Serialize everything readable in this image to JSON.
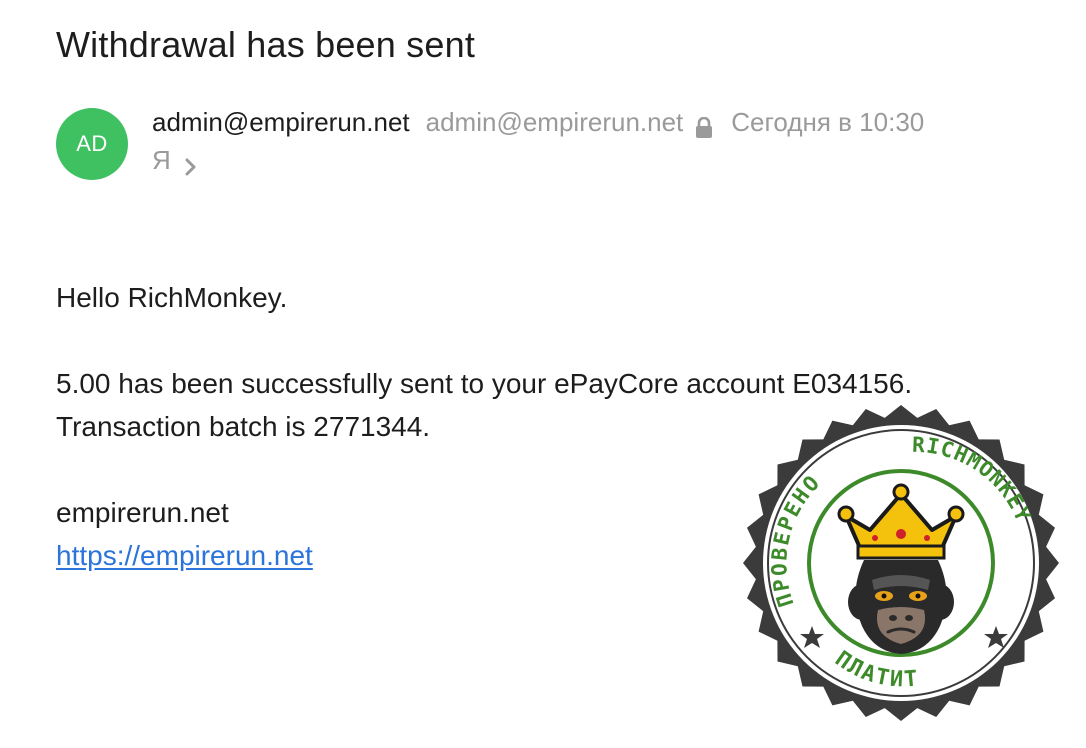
{
  "email": {
    "subject": "Withdrawal has been sent",
    "avatar_initials": "AD",
    "sender_name": "admin@empirerun.net",
    "sender_email": "admin@empirerun.net",
    "date": "Сегодня в 10:30",
    "recipient": "Я",
    "greeting": "Hello RichMonkey.",
    "message_line1": "5.00 has been successfully sent to your ePayCore account E034156.",
    "message_line2": "Transaction batch is 2771344.",
    "signature_site": "empirerun.net",
    "signature_link": "https://empirerun.net"
  },
  "stamp": {
    "text_top_left": "ПРОВЕРЕНО",
    "text_top_right": "RICHMONKEY",
    "text_bottom": "ПЛАТИТ"
  },
  "colors": {
    "avatar": "#3fc162",
    "link": "#2b74d9",
    "muted": "#9a9a9a",
    "stamp_green": "#3c8a2a",
    "stamp_ring": "#3b3b3b",
    "crown": "#f4c20d"
  },
  "icons": {
    "lock": "lock-icon",
    "chevron": "chevron-right-icon"
  }
}
